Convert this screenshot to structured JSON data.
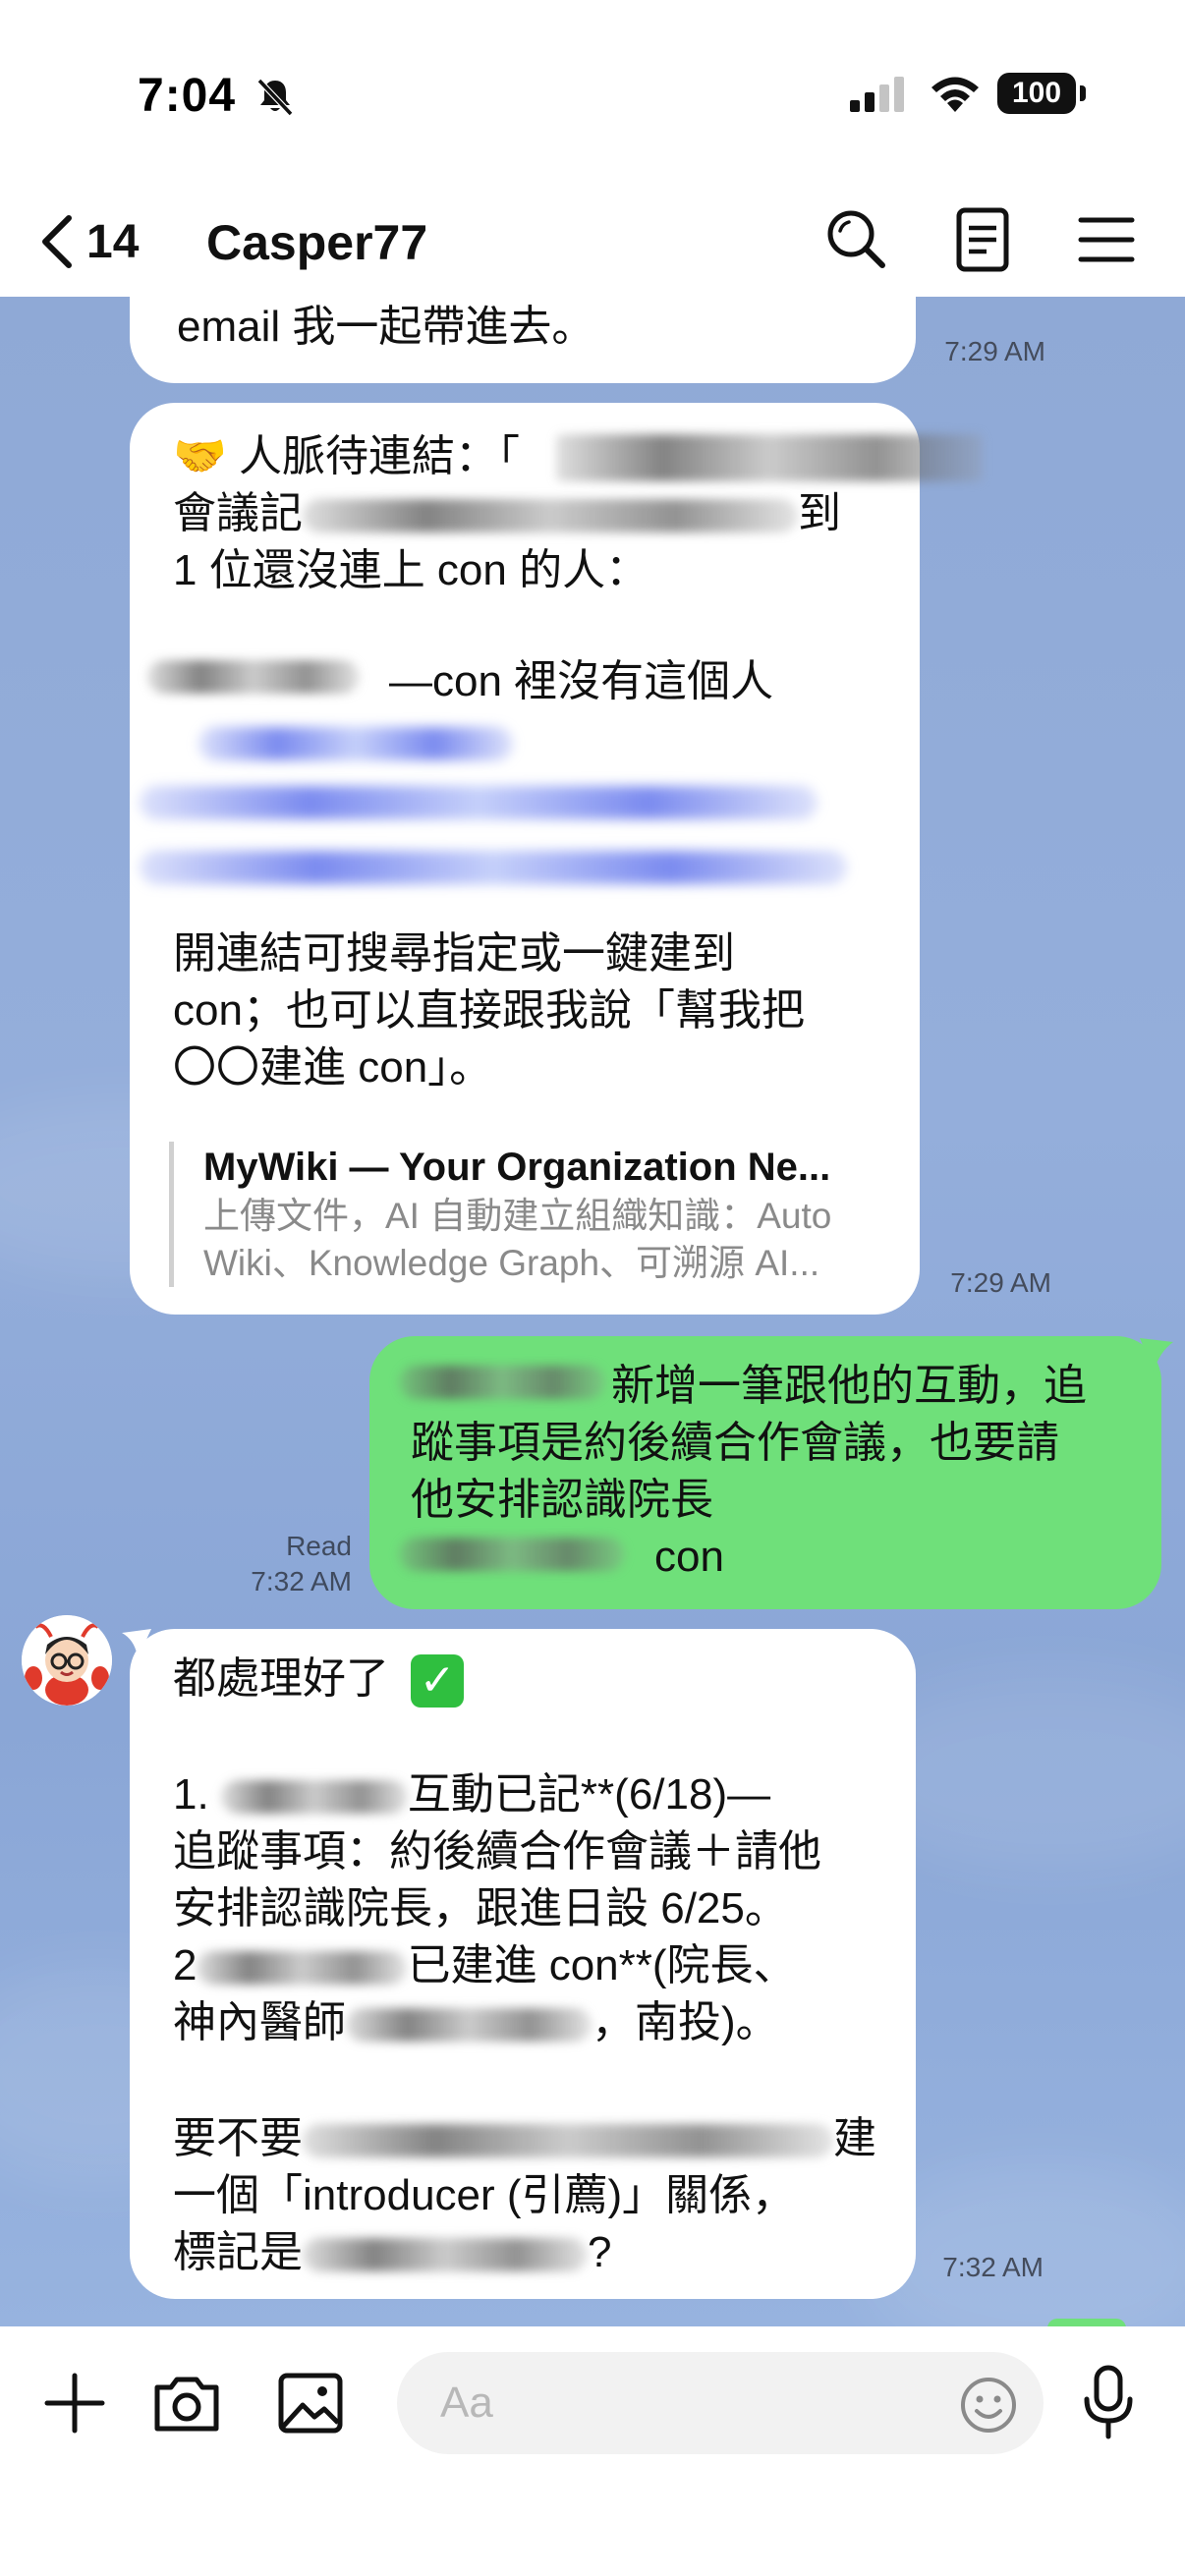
{
  "status_bar": {
    "time": "7:04",
    "battery": "100"
  },
  "header": {
    "back_count": "14",
    "title": "Casper77"
  },
  "messages": [
    {
      "text": "email 我一起帶進去。",
      "time": "7:29 AM"
    },
    {
      "line1": "人脈待連結：「",
      "line2a": "會議記",
      "line2b": "到",
      "line3": "1 位還沒連上 con 的人：",
      "line4": "—con 裡沒有這個人",
      "para2": [
        "開連結可搜尋指定或一鍵建到",
        "con；也可以直接跟我說「幫我把",
        "〇〇建進 con」。"
      ],
      "link_title": "MyWiki — Your Organization Ne...",
      "link_desc": [
        "上傳文件，AI 自動建立組織知識：Auto",
        "Wiki、Knowledge Graph、可溯源 AI..."
      ],
      "time": "7:29 AM"
    },
    {
      "line1": "新增一筆跟他的互動，追",
      "line2": "蹤事項是約後續合作會議，也要請",
      "line3": "他安排認識院長",
      "line4": "con",
      "read": "Read",
      "time": "7:32 AM"
    },
    {
      "line1": "都處理好了",
      "item1a": "1. ",
      "item1b": "互動已記**(6/18)—",
      "item1c": "追蹤事項：約後續合作會議＋請他",
      "item1d": "安排認識院長，跟進日設 6/25。",
      "item2a": "2",
      "item2b": "已建進 con**(院長、",
      "item2c": "神內醫師",
      "item2d": "，南投)。",
      "q1": "要不要",
      "q1b": "建",
      "q2": "一個「introducer (引薦)」關係，",
      "q3a": "標記是",
      "q3b": "?",
      "time": "7:32 AM"
    }
  ],
  "composer": {
    "placeholder": "Aa"
  },
  "colors": {
    "chat_bg": "#8fa9d6",
    "my_bubble": "#6fe07a",
    "their_bubble": "#ffffff"
  },
  "icons": [
    "back-chevron-icon",
    "search-icon",
    "notes-icon",
    "menu-icon",
    "plus-icon",
    "camera-icon",
    "image-icon",
    "emoji-icon",
    "mic-icon",
    "arrow-down-icon"
  ]
}
